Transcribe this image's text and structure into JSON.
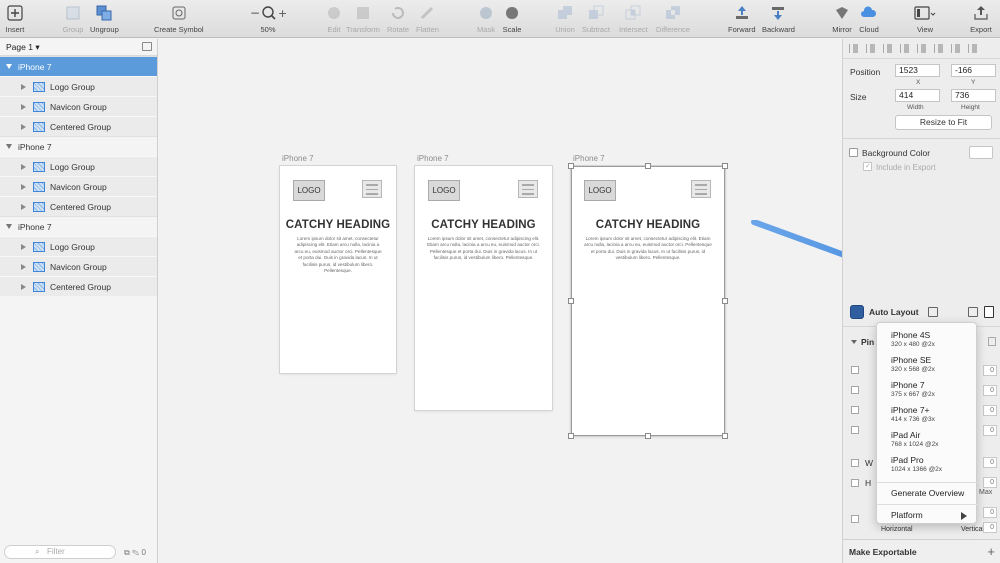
{
  "toolbar": {
    "insert": "Insert",
    "group": "Group",
    "ungroup": "Ungroup",
    "create_symbol": "Create Symbol",
    "zoom": "50%",
    "edit": "Edit",
    "transform": "Transform",
    "rotate": "Rotate",
    "flatten": "Flatten",
    "mask": "Mask",
    "scale": "Scale",
    "union": "Union",
    "subtract": "Subtract",
    "intersect": "Intersect",
    "difference": "Difference",
    "forward": "Forward",
    "backward": "Backward",
    "mirror": "Mirror",
    "cloud": "Cloud",
    "view": "View",
    "export": "Export"
  },
  "layers": {
    "page": "Page 1",
    "artboards": [
      {
        "name": "iPhone 7",
        "groups": [
          "Logo Group",
          "Navicon Group",
          "Centered Group"
        ]
      },
      {
        "name": "iPhone 7",
        "groups": [
          "Logo Group",
          "Navicon Group",
          "Centered Group"
        ]
      },
      {
        "name": "iPhone 7",
        "groups": [
          "Logo Group",
          "Navicon Group",
          "Centered Group"
        ]
      }
    ],
    "filter_placeholder": "Filter",
    "filter_count": "0"
  },
  "canvas": {
    "artboards": [
      {
        "label": "iPhone 7",
        "logo": "LOGO",
        "heading": "CATCHY HEADING",
        "body": "Lorem ipsum dolor sit amet, consectetur adipiscing elit. Etiam arcu nulla, lacinia a arcu eu, euismod auctor orci. Pellentesque et porta dui. Duis in gravida lacus. In ut facilisis purus, id vestibulum libero. Pellentesque."
      },
      {
        "label": "iPhone 7",
        "logo": "LOGO",
        "heading": "CATCHY HEADING",
        "body": "Lorem ipsum dolor sit amet, consectetur adipiscing elit. Etiam arcu nulla, lacinia a arcu eu, euismod auctor orci. Pellentesque et porta dui. Duis in gravida lacus. In ut facilisis purus, id vestibulum libero. Pellentesque."
      },
      {
        "label": "iPhone 7",
        "logo": "LOGO",
        "heading": "CATCHY HEADING",
        "body": "Lorem ipsum dolor sit amet, consectetur adipiscing elit. Etiam arcu nulla, lacinia a arcu eu, euismod auctor orci. Pellentesque et porta dui. Duis in gravida lacus. In ut facilisis purus, id vestibulum libero. Pellentesque."
      }
    ]
  },
  "inspector": {
    "position_label": "Position",
    "x": "1523",
    "y": "-166",
    "x_label": "X",
    "y_label": "Y",
    "size_label": "Size",
    "width": "414",
    "height": "736",
    "width_label": "Width",
    "height_label": "Height",
    "resize_to_fit": "Resize to Fit",
    "background_color": "Background Color",
    "include_in_export": "Include in Export",
    "auto_layout": "Auto Layout",
    "pin": "Pin",
    "w": "W",
    "h": "H",
    "max": "Max",
    "horizontal": "Horizontal",
    "vertical": "Vertical",
    "make_exportable": "Make Exportable",
    "pin_values": [
      "0",
      "0",
      "0",
      "0",
      "0",
      "0",
      "0",
      "0"
    ]
  },
  "device_menu": {
    "items": [
      {
        "name": "iPhone 4S",
        "size": "320 x 480 @2x"
      },
      {
        "name": "iPhone SE",
        "size": "320 x 568 @2x"
      },
      {
        "name": "iPhone 7",
        "size": "375 x 667 @2x"
      },
      {
        "name": "iPhone 7+",
        "size": "414 x 736 @3x"
      },
      {
        "name": "iPad Air",
        "size": "768 x 1024 @2x"
      },
      {
        "name": "iPad Pro",
        "size": "1024 x 1366 @2x"
      }
    ],
    "generate_overview": "Generate Overview",
    "platform": "Platform"
  },
  "colors": {
    "selection": "#5b9bdc",
    "arrow": "#4a90e2",
    "folder_icon": "#3f86d8"
  }
}
